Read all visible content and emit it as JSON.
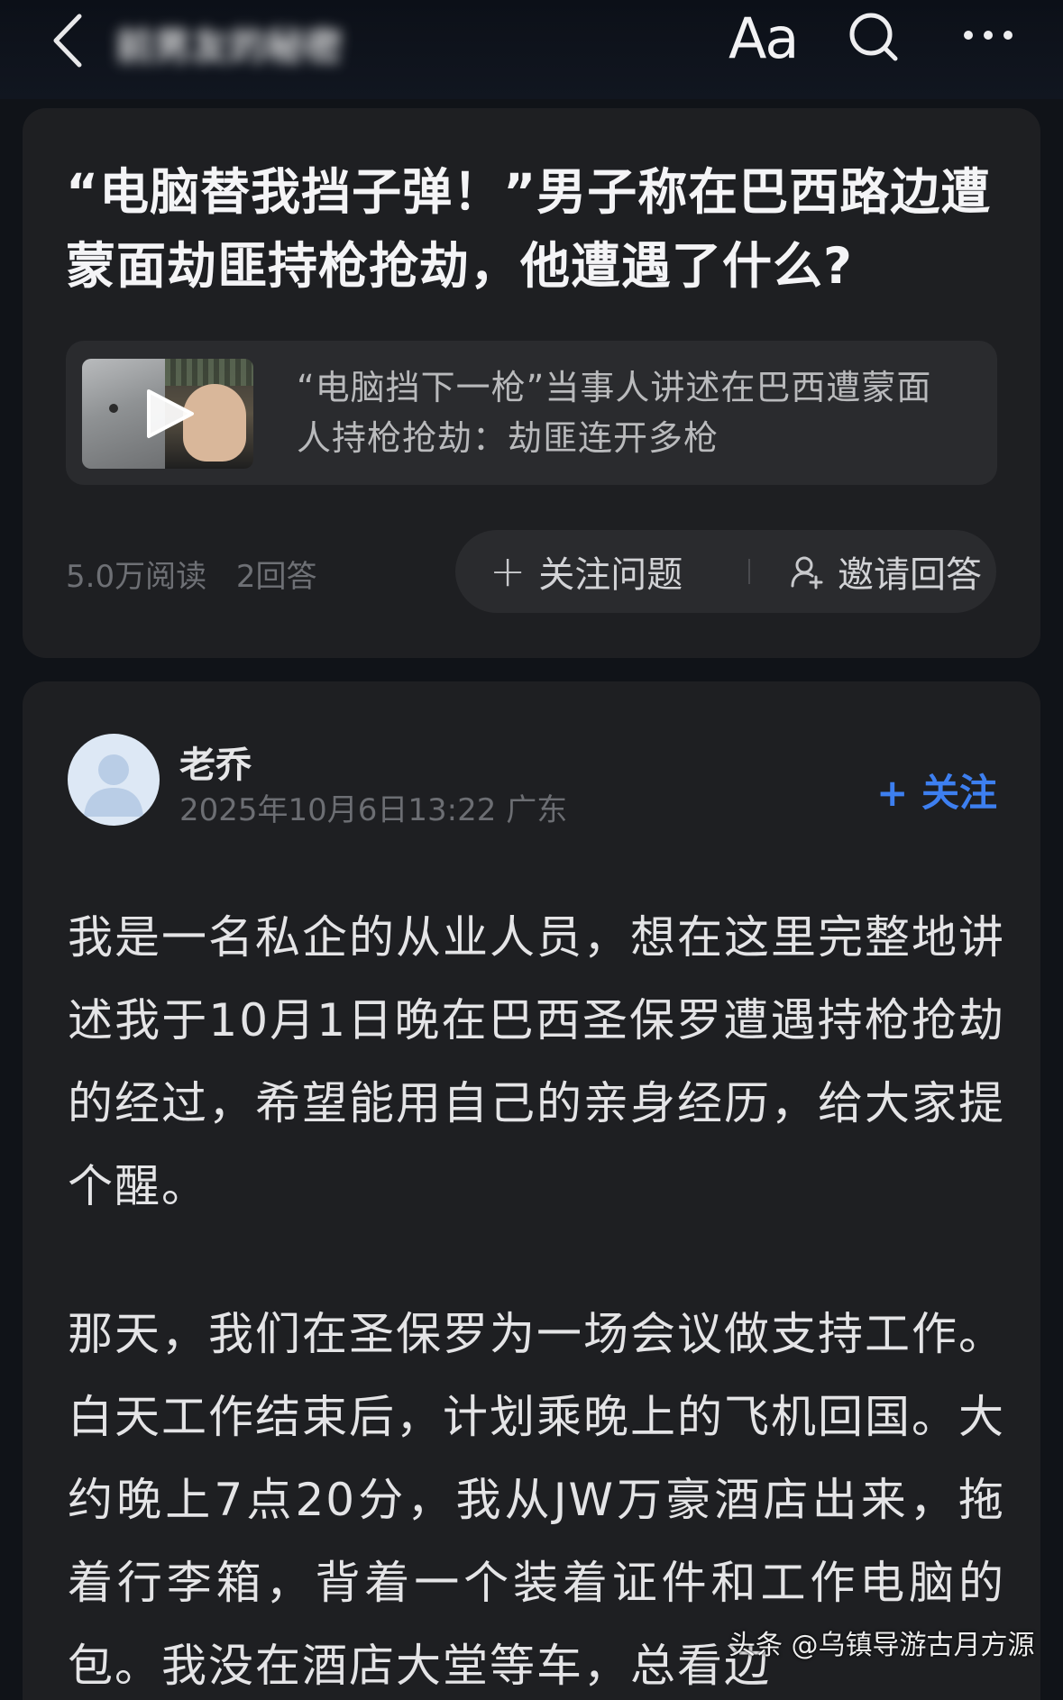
{
  "topbar": {
    "title": "前男友的秘密",
    "font_button_label": "Aa"
  },
  "question": {
    "title": "“电脑替我挡子弹！”男子称在巴西路边遭蒙面劫匪持枪抢劫，他遭遇了什么?",
    "related_video": {
      "title": "“电脑挡下一枪”当事人讲述在巴西遭蒙面人持枪抢劫：劫匪连开多枪"
    },
    "views": "5.0万阅读",
    "answers": "2回答",
    "follow_label": "关注问题",
    "invite_label": "邀请回答"
  },
  "answer": {
    "author": "老乔",
    "meta": "2025年10月6日13:22 广东",
    "follow_label": "+ 关注",
    "paragraphs": [
      "我是一名私企的从业人员，想在这里完整地讲述我于10月1日晚在巴西圣保罗遭遇持枪抢劫的经过，希望能用自己的亲身经历，给大家提个醒。",
      "那天，我们在圣保罗为一场会议做支持工作。白天工作结束后，计划乘晚上的飞机回国。大约晚上7点20分，我从JW万豪酒店出来，拖着行李箱，背着一个装着证件和工作电脑的包。我没在酒店大堂等车，总看边"
    ]
  },
  "watermark": "头条 @乌镇导游古月方源",
  "colors": {
    "accent": "#3d7ff0",
    "card_bg": "#1e1f22",
    "page_bg": "#101318"
  }
}
